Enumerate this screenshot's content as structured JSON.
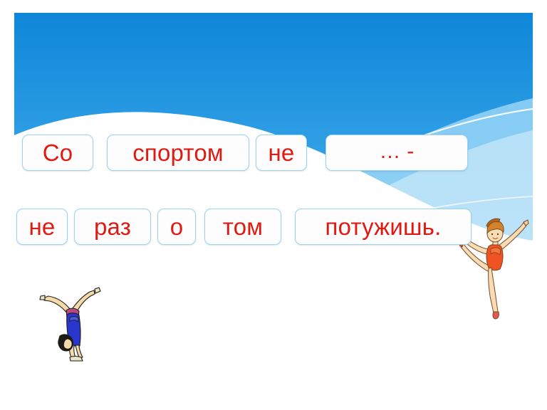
{
  "slide": {
    "kind": "language-exercise-slide",
    "background": {
      "panel_gradient_top": "#0f86d9",
      "panel_gradient_bottom": "#8ad3f7",
      "wave_color": "#ffffff",
      "wave_secondary_color": "#b6e4fb",
      "page_background": "#ffffff"
    },
    "card_style": {
      "fill": "#fdfdfd",
      "border": "#9ad4f0",
      "text_color": "#e01a13"
    }
  },
  "exercise": {
    "full_sentence": "Со спортом не … - не раз о том потужишь.",
    "rows": [
      {
        "id": "row-1",
        "cards": [
          {
            "label": "Со",
            "is_blank": false
          },
          {
            "label": "спортом",
            "is_blank": false
          },
          {
            "label": "не",
            "is_blank": false
          },
          {
            "label": "… -",
            "is_blank": true
          }
        ]
      },
      {
        "id": "row-2",
        "cards": [
          {
            "label": "не",
            "is_blank": false
          },
          {
            "label": "раз",
            "is_blank": false
          },
          {
            "label": "о",
            "is_blank": false
          },
          {
            "label": "том",
            "is_blank": false
          },
          {
            "label": "потужишь.",
            "is_blank": false
          }
        ]
      }
    ]
  },
  "illustrations": [
    {
      "name": "gymnast-handstand",
      "description": "gymnast girl in blue leotard performing a handstand",
      "leotard_color": "#2a37cf",
      "skin_color": "#f5d9a8",
      "hair_color": "#1d1b18"
    },
    {
      "name": "gymnast-standing",
      "description": "gymnast girl in orange-red leotard balancing on one leg with arms raised",
      "leotard_color": "#ef5223",
      "skin_color": "#f7dcb4",
      "hair_color": "#d4832b"
    }
  ]
}
